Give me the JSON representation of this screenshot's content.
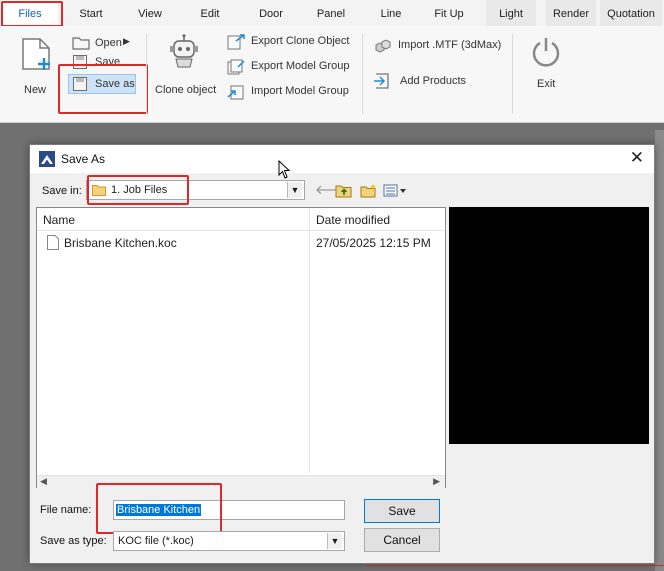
{
  "menubar": {
    "items": [
      "Files",
      "Start",
      "View",
      "Edit",
      "Door",
      "Panel",
      "Line",
      "Fit Up",
      "Light",
      "Render",
      "Quotation"
    ]
  },
  "ribbon": {
    "new_label": "New",
    "open_label": "Open",
    "save_label": "Save",
    "save_as_label": "Save as",
    "clone_object_label": "Clone object",
    "export_clone_object_label": "Export Clone Object",
    "export_model_group_label": "Export Model Group",
    "import_model_group_label": "Import Model Group",
    "import_mtf_label": "Import .MTF (3dMax)",
    "add_products_label": "Add Products",
    "exit_label": "Exit"
  },
  "dialog": {
    "title": "Save As",
    "save_in_label": "Save in:",
    "save_in_value": "1. Job Files",
    "columns": [
      "Name",
      "Date modified"
    ],
    "files": [
      {
        "name": "Brisbane Kitchen.koc",
        "date": "27/05/2025 12:15 PM"
      }
    ],
    "file_name_label": "File name:",
    "file_name_value": "Brisbane Kitchen",
    "save_as_type_label": "Save as type:",
    "save_as_type_value": "KOC file (*.koc)",
    "save_button": "Save",
    "cancel_button": "Cancel"
  },
  "colors": {
    "highlight_red": "#e0272a",
    "selection_blue": "#0078d7",
    "preview_black": "#000000"
  }
}
